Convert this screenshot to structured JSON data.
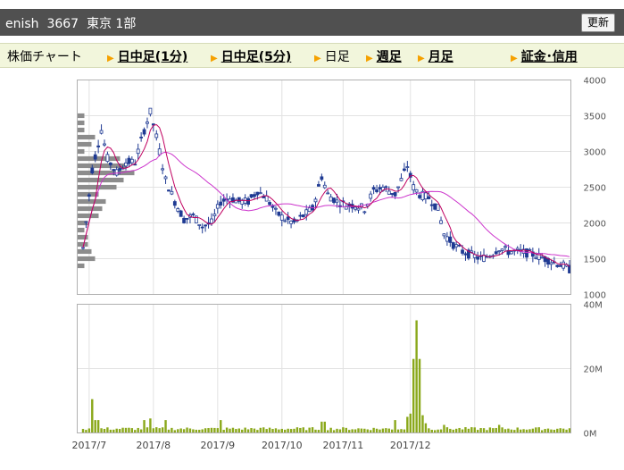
{
  "header": {
    "title": "enish  3667  東京 1部",
    "refresh_label": "更新"
  },
  "nav": {
    "items": [
      {
        "label": "株価チャート",
        "link": false,
        "arrow": false
      },
      {
        "label": "日中足(1分)",
        "link": true,
        "arrow": true
      },
      {
        "label": "日中足(5分)",
        "link": true,
        "arrow": true
      },
      {
        "label": "日足",
        "link": false,
        "arrow": true
      },
      {
        "label": "週足",
        "link": true,
        "arrow": true
      },
      {
        "label": "月足",
        "link": true,
        "arrow": true
      },
      {
        "label": "証金･信用",
        "link": true,
        "arrow": true
      }
    ]
  },
  "chart_data": [
    {
      "type": "candlestick",
      "title": "",
      "ylim": [
        1000,
        4000
      ],
      "y_ticks": [
        "4000",
        "3500",
        "3000",
        "2500",
        "2000",
        "1500",
        "1000"
      ],
      "x_labels": [
        "2017/7",
        "2017/8",
        "2017/9",
        "2017/10",
        "2017/11",
        "2017/12"
      ],
      "grid": true,
      "colors": {
        "candle": "#1f3a93",
        "ma_short": "#c00060",
        "ma_long": "#cc33cc",
        "volume_profile": "#8c8c8c"
      },
      "price_keypoints": [
        [
          0,
          1650
        ],
        [
          3,
          2750
        ],
        [
          6,
          3300
        ],
        [
          8,
          2900
        ],
        [
          11,
          2700
        ],
        [
          14,
          2850
        ],
        [
          17,
          2850
        ],
        [
          20,
          3300
        ],
        [
          22,
          3550
        ],
        [
          24,
          3200
        ],
        [
          27,
          2600
        ],
        [
          30,
          2300
        ],
        [
          33,
          2050
        ],
        [
          36,
          2100
        ],
        [
          39,
          1950
        ],
        [
          42,
          2000
        ],
        [
          45,
          2300
        ],
        [
          48,
          2350
        ],
        [
          51,
          2300
        ],
        [
          54,
          2300
        ],
        [
          57,
          2450
        ],
        [
          60,
          2350
        ],
        [
          63,
          2150
        ],
        [
          66,
          2050
        ],
        [
          69,
          2000
        ],
        [
          72,
          2100
        ],
        [
          75,
          2200
        ],
        [
          78,
          2650
        ],
        [
          80,
          2400
        ],
        [
          83,
          2300
        ],
        [
          86,
          2250
        ],
        [
          89,
          2250
        ],
        [
          92,
          2200
        ],
        [
          95,
          2450
        ],
        [
          98,
          2500
        ],
        [
          100,
          2450
        ],
        [
          102,
          2400
        ],
        [
          104,
          2600
        ],
        [
          106,
          2800
        ],
        [
          108,
          2500
        ],
        [
          110,
          2400
        ],
        [
          113,
          2350
        ],
        [
          116,
          2200
        ],
        [
          118,
          1850
        ],
        [
          121,
          1700
        ],
        [
          124,
          1600
        ],
        [
          127,
          1550
        ],
        [
          130,
          1500
        ],
        [
          133,
          1550
        ],
        [
          136,
          1650
        ],
        [
          139,
          1600
        ],
        [
          142,
          1600
        ],
        [
          145,
          1580
        ],
        [
          148,
          1550
        ],
        [
          151,
          1500
        ],
        [
          154,
          1450
        ],
        [
          157,
          1400
        ],
        [
          159,
          1350
        ]
      ],
      "volume_profile_bins": [
        {
          "price": 1400,
          "value": 2
        },
        {
          "price": 1500,
          "value": 5
        },
        {
          "price": 1600,
          "value": 4
        },
        {
          "price": 1700,
          "value": 3
        },
        {
          "price": 1800,
          "value": 3
        },
        {
          "price": 1900,
          "value": 2
        },
        {
          "price": 2000,
          "value": 3
        },
        {
          "price": 2100,
          "value": 6
        },
        {
          "price": 2200,
          "value": 7
        },
        {
          "price": 2300,
          "value": 8
        },
        {
          "price": 2400,
          "value": 6
        },
        {
          "price": 2500,
          "value": 11
        },
        {
          "price": 2600,
          "value": 13
        },
        {
          "price": 2700,
          "value": 16
        },
        {
          "price": 2800,
          "value": 14
        },
        {
          "price": 2900,
          "value": 12
        },
        {
          "price": 3000,
          "value": 2
        },
        {
          "price": 3100,
          "value": 4
        },
        {
          "price": 3200,
          "value": 5
        },
        {
          "price": 3300,
          "value": 2
        },
        {
          "price": 3400,
          "value": 2
        },
        {
          "price": 3500,
          "value": 2
        }
      ]
    },
    {
      "type": "bar",
      "title": "",
      "ylim": [
        0,
        40
      ],
      "y_ticks": [
        "40M",
        "20M",
        "0M"
      ],
      "color": "#8aa81a",
      "volume_baseline_M": 1.2,
      "volume_spikes_M": [
        {
          "day": 3,
          "value": 10.5
        },
        {
          "day": 4,
          "value": 4.0
        },
        {
          "day": 5,
          "value": 4.0
        },
        {
          "day": 20,
          "value": 4.0
        },
        {
          "day": 22,
          "value": 4.5
        },
        {
          "day": 27,
          "value": 4.0
        },
        {
          "day": 45,
          "value": 4.0
        },
        {
          "day": 78,
          "value": 3.5
        },
        {
          "day": 79,
          "value": 3.5
        },
        {
          "day": 102,
          "value": 4.0
        },
        {
          "day": 106,
          "value": 5.0
        },
        {
          "day": 107,
          "value": 6.0
        },
        {
          "day": 108,
          "value": 23.0
        },
        {
          "day": 109,
          "value": 35.0
        },
        {
          "day": 110,
          "value": 23.0
        },
        {
          "day": 111,
          "value": 5.5
        },
        {
          "day": 112,
          "value": 3.0
        },
        {
          "day": 118,
          "value": 2.5
        },
        {
          "day": 136,
          "value": 2.5
        }
      ]
    }
  ]
}
